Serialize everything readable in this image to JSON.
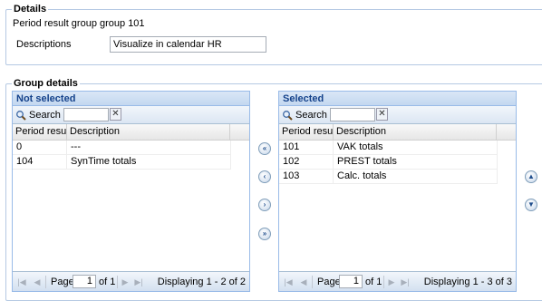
{
  "details": {
    "legend": "Details",
    "heading": "Period result group group 101",
    "descriptions_label": "Descriptions",
    "descriptions_value": "Visualize in calendar HR"
  },
  "group_details": {
    "legend": "Group details",
    "not_selected": {
      "title": "Not selected",
      "search_label": "Search",
      "search_value": "",
      "clear_glyph": "✕",
      "columns": [
        "Period resul...",
        "Description"
      ],
      "rows": [
        {
          "period": "0",
          "description": "---"
        },
        {
          "period": "104",
          "description": "SynTime totals"
        }
      ],
      "pager": {
        "page_label": "Page",
        "page": "1",
        "of_label": "of 1",
        "display": "Displaying 1 - 2 of 2"
      }
    },
    "selected": {
      "title": "Selected",
      "search_label": "Search",
      "search_value": "",
      "clear_glyph": "✕",
      "columns": [
        "Period resul...",
        "Description"
      ],
      "rows": [
        {
          "period": "101",
          "description": "VAK totals"
        },
        {
          "period": "102",
          "description": "PREST totals"
        },
        {
          "period": "103",
          "description": "Calc. totals"
        }
      ],
      "pager": {
        "page_label": "Page",
        "page": "1",
        "of_label": "of 1",
        "display": "Displaying 1 - 3 of 3"
      }
    },
    "move_buttons": {
      "add_all": "«",
      "add_one": "‹",
      "remove_one": "›",
      "remove_all": "»",
      "up": "▲",
      "down": "▼"
    }
  }
}
